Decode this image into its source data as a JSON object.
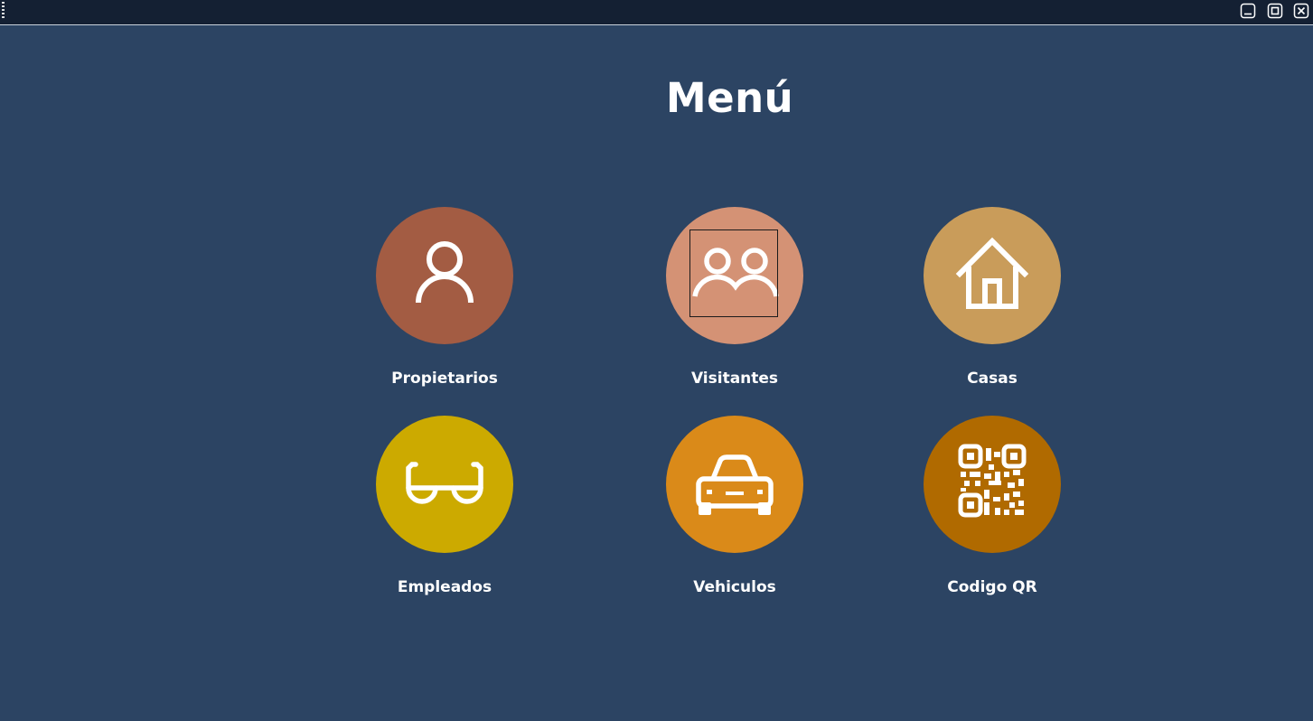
{
  "window": {
    "controls": [
      {
        "name": "minimize",
        "icon": "minimize-icon"
      },
      {
        "name": "maximize",
        "icon": "maximize-icon"
      },
      {
        "name": "close",
        "icon": "close-icon"
      }
    ]
  },
  "title": "Menú",
  "tiles": [
    {
      "label": "Propietarios",
      "icon": "person-icon",
      "color": "#a35c43"
    },
    {
      "label": "Visitantes",
      "icon": "people-icon",
      "color": "#d49275"
    },
    {
      "label": "Casas",
      "icon": "house-icon",
      "color": "#c99c5a"
    },
    {
      "label": "Empleados",
      "icon": "glasses-icon",
      "color": "#ccaa00"
    },
    {
      "label": "Vehiculos",
      "icon": "car-icon",
      "color": "#da8a19"
    },
    {
      "label": "Codigo QR",
      "icon": "qr-code-icon",
      "color": "#b06a00"
    }
  ],
  "colors": {
    "background": "#2c4463",
    "titlebar": "#142033",
    "text": "#ffffff"
  }
}
